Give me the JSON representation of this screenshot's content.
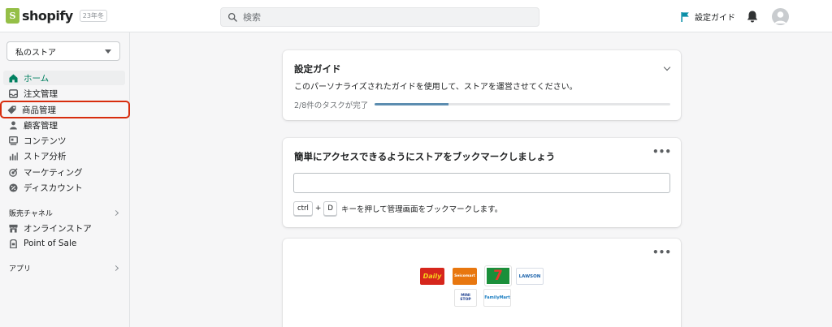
{
  "app": {
    "name": "shopify",
    "badge": "23年冬",
    "brand_color": "#95bf47"
  },
  "topbar": {
    "search_placeholder": "検索",
    "setup_guide_label": "設定ガイド"
  },
  "sidebar": {
    "store_select": "私のストア",
    "items": [
      {
        "label": "ホーム",
        "icon": "home-icon",
        "active": true
      },
      {
        "label": "注文管理",
        "icon": "inbox-icon"
      },
      {
        "label": "商品管理",
        "icon": "tag-icon",
        "highlighted": true
      },
      {
        "label": "顧客管理",
        "icon": "person-icon"
      },
      {
        "label": "コンテンツ",
        "icon": "content-icon"
      },
      {
        "label": "ストア分析",
        "icon": "bar-chart-icon"
      },
      {
        "label": "マーケティング",
        "icon": "target-icon"
      },
      {
        "label": "ディスカウント",
        "icon": "discount-icon"
      }
    ],
    "sales_channels": {
      "title": "販売チャネル",
      "items": [
        {
          "label": "オンラインストア",
          "icon": "store-icon"
        },
        {
          "label": "Point of Sale",
          "icon": "pos-icon"
        }
      ]
    },
    "apps_title": "アプリ"
  },
  "setup_card": {
    "title": "設定ガイド",
    "description": "このパーソナライズされたガイドを使用して、ストアを運営させてください。",
    "progress_text": "2/8件のタスクが完了",
    "progress_fraction": 0.25
  },
  "bookmark_card": {
    "title": "簡単にアクセスできるようにストアをブックマークしましょう",
    "input_value": "",
    "key1": "ctrl",
    "plus": "+",
    "key2": "D",
    "instruction": "キーを押して管理画面をブックマークします。"
  },
  "convenience_card": {
    "logos": [
      {
        "name": "daily-yamazaki-logo",
        "text": "Daily",
        "bg": "#d6261c",
        "fg": "#f7d21b"
      },
      {
        "name": "seicomart-logo",
        "text": "Seicomart",
        "bg": "#e8770f",
        "fg": "#ffffff"
      },
      {
        "name": "seven-eleven-logo",
        "text": "7",
        "bg": "#1a8f3a",
        "fg": "#e8382c"
      },
      {
        "name": "lawson-logo",
        "text": "LAWSON",
        "bg": "#ffffff",
        "fg": "#1d64ac"
      },
      {
        "name": "ministop-logo",
        "text": "MINI STOP",
        "bg": "#ffffff",
        "fg": "#1d3f8f"
      },
      {
        "name": "familymart-logo",
        "text": "FamilyMart",
        "bg": "#ffffff",
        "fg": "#1d7fc2"
      }
    ]
  }
}
